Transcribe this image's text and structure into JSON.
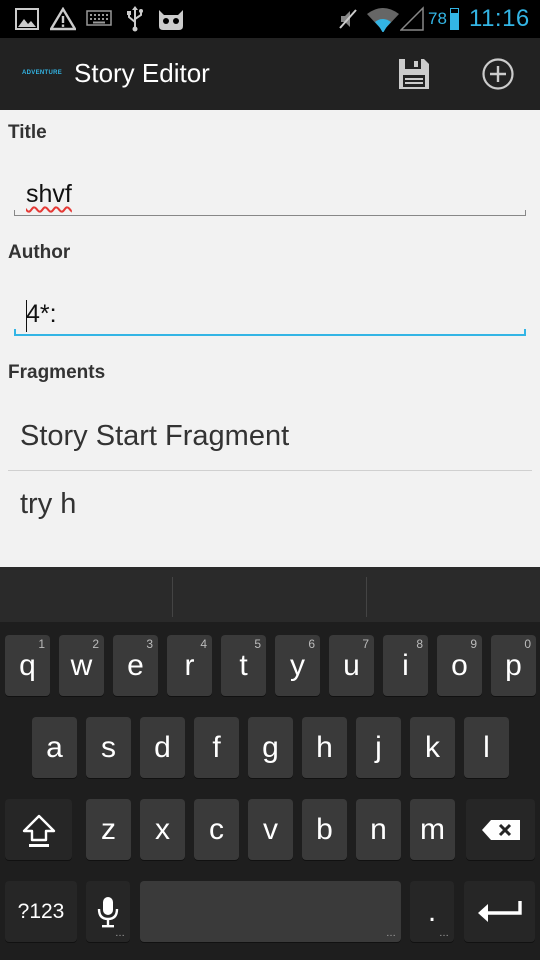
{
  "status_bar": {
    "battery_text": "78",
    "battery_level": 0.78,
    "time": "11:16",
    "accent_color": "#33b5e5",
    "icons": [
      "image-icon",
      "warning-icon",
      "keyboard-icon",
      "usb-icon",
      "cyanogen-icon",
      "mute-icon",
      "wifi-icon",
      "signal-icon",
      "battery-icon"
    ]
  },
  "action_bar": {
    "logo_text": "ADVENTURE",
    "title": "Story Editor",
    "actions": [
      "save-icon",
      "add-icon"
    ]
  },
  "form": {
    "title_label": "Title",
    "title_value": "shvf",
    "author_label": "Author",
    "author_value": "4*:",
    "fragments_label": "Fragments"
  },
  "fragments": [
    "Story Start Fragment",
    "try h"
  ],
  "keyboard": {
    "row1": [
      {
        "k": "q",
        "h": "1"
      },
      {
        "k": "w",
        "h": "2"
      },
      {
        "k": "e",
        "h": "3"
      },
      {
        "k": "r",
        "h": "4"
      },
      {
        "k": "t",
        "h": "5"
      },
      {
        "k": "y",
        "h": "6"
      },
      {
        "k": "u",
        "h": "7"
      },
      {
        "k": "i",
        "h": "8"
      },
      {
        "k": "o",
        "h": "9"
      },
      {
        "k": "p",
        "h": "0"
      }
    ],
    "row2": [
      "a",
      "s",
      "d",
      "f",
      "g",
      "h",
      "j",
      "k",
      "l"
    ],
    "row3": [
      "z",
      "x",
      "c",
      "v",
      "b",
      "n",
      "m"
    ],
    "symbols_label": "?123",
    "period_label": "."
  }
}
